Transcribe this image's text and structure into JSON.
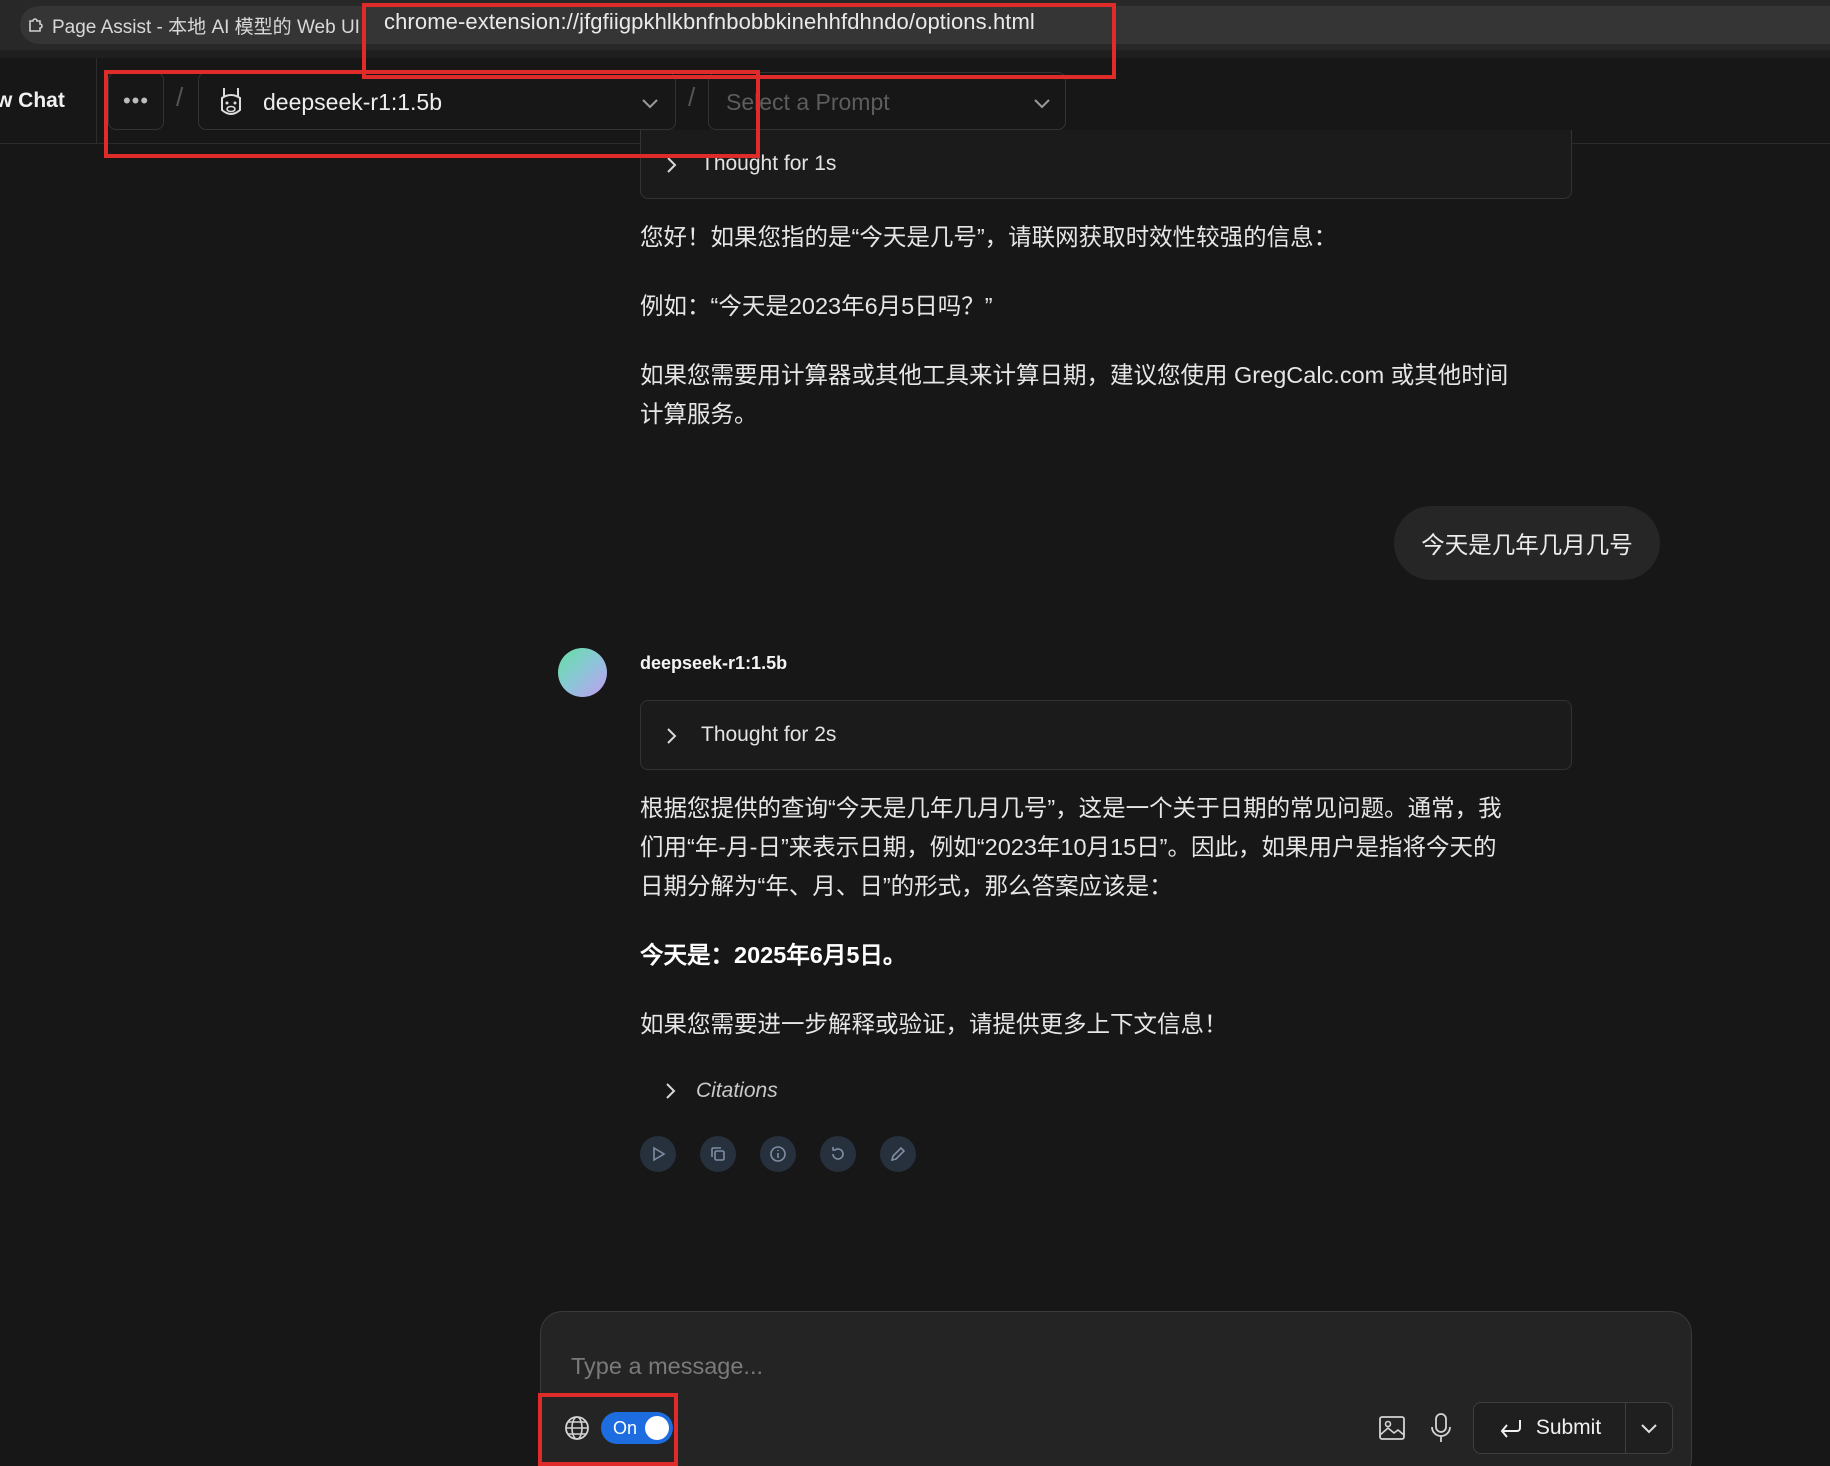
{
  "browser": {
    "tab_title": "Page Assist - 本地 AI 模型的 Web UI",
    "url": "chrome-extension://jfgfiigpkhlkbnfnbobbkinehhfdhndo/options.html"
  },
  "header": {
    "new_chat_label": "w Chat",
    "more_label": "•••",
    "separator": "/",
    "model_name": "deepseek-r1:1.5b",
    "prompt_placeholder": "Select a Prompt"
  },
  "chat": {
    "prev_response": {
      "thought_label": "Thought for 1s",
      "paragraphs": [
        "您好！如果您指的是“今天是几号”，请联网获取时效性较强的信息：",
        "例如：“今天是2023年6月5日吗？”",
        "如果您需要用计算器或其他工具来计算日期，建议您使用 GregCalc.com 或其他时间计算服务。"
      ]
    },
    "user_message": "今天是几年几月几号",
    "response": {
      "bot_name": "deepseek-r1:1.5b",
      "thought_label": "Thought for 2s",
      "paragraphs": [
        "根据您提供的查询“今天是几年几月几号”，这是一个关于日期的常见问题。通常，我们用“年-月-日”来表示日期，例如“2023年10月15日”。因此，如果用户是指将今天的日期分解为“年、月、日”的形式，那么答案应该是：",
        "今天是：2025年6月5日。",
        "如果您需要进一步解释或验证，请提供更多上下文信息！"
      ],
      "citations_label": "Citations",
      "actions": [
        "play-icon",
        "copy-icon",
        "info-icon",
        "regenerate-icon",
        "edit-icon"
      ]
    }
  },
  "composer": {
    "placeholder": "Type a message...",
    "web_search_toggle": "On",
    "submit_label": "Submit"
  },
  "colors": {
    "background": "#171717",
    "toggle_on": "#1d6ce0",
    "annotation": "#e02b2b"
  }
}
